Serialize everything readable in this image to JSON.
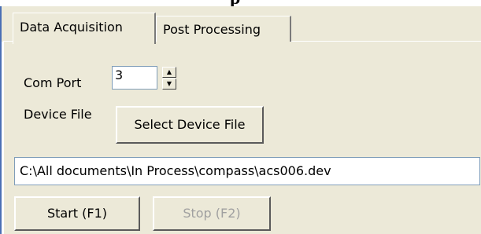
{
  "tabs": {
    "active_label": "Data Acquisition",
    "inactive_label": "Post Processing"
  },
  "com_port": {
    "label": "Com Port",
    "value": "3"
  },
  "device_file": {
    "label": "Device File",
    "select_button_label": "Select Device File",
    "path_value": "C:\\All documents\\In Process\\compass\\acs006.dev"
  },
  "controls": {
    "start_label": "Start (F1)",
    "stop_label": "Stop (F2)",
    "stop_enabled": false
  },
  "icons": {
    "spin_up": "spin-up-icon",
    "spin_down": "spin-down-icon"
  },
  "colors": {
    "panel_bg": "#ece9d8",
    "input_border": "#7f9db9",
    "disabled_text": "#a0a0a0",
    "left_accent": "#4a6fb5"
  }
}
